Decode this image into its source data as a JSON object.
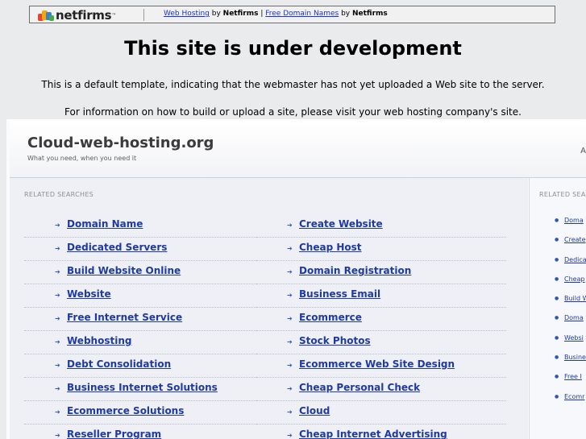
{
  "banner": {
    "logo_text": "netfirms",
    "logo_tm": "™",
    "link_hosting": "Web Hosting",
    "by1": " by ",
    "brand1": "Netfirms",
    "pipe": " | ",
    "link_domains": "Free Domain Names",
    "by2": " by ",
    "brand2": "Netfirms"
  },
  "heading": "This site is under development",
  "info_line_1": "This is a default template, indicating that the webmaster has not yet uploaded a Web site to the server.",
  "info_line_2": "For information on how to build or upload a site, please visit your web hosting company's site.",
  "site": {
    "title": "Cloud-web-hosting.org",
    "tagline": "What you need, when you need it",
    "header_mark": "A"
  },
  "related_title": "RELATED SEARCHES",
  "side_related_title": "RELATED SEA",
  "left_links": [
    "Domain Name",
    "Dedicated Servers",
    "Build Website Online",
    "Website",
    "Free Internet Service",
    "Webhosting",
    "Debt Consolidation",
    "Business Internet Solutions",
    "Ecommerce Solutions",
    "Reseller Program"
  ],
  "right_links": [
    "Create Website",
    "Cheap Host",
    "Domain Registration",
    "Business Email",
    "Ecommerce",
    "Stock Photos",
    "Ecommerce Web Site Design",
    "Cheap Personal Check",
    "Cloud",
    "Cheap Internet Advertising"
  ],
  "side_links": [
    "Doma",
    "Create",
    "Dedica",
    "Cheap",
    "Build W",
    "Doma",
    "Websi",
    "Busine",
    "Free I",
    "Ecomr"
  ],
  "bullet_glyph": "➔",
  "dot_glyph": "●"
}
